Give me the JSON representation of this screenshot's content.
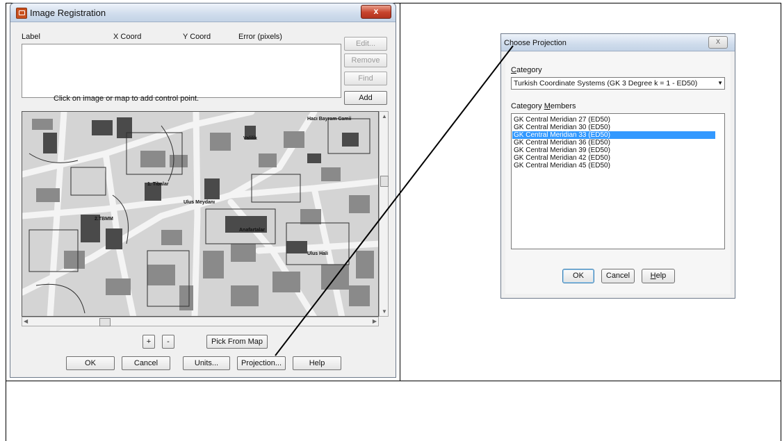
{
  "image_registration": {
    "title": "Image Registration",
    "close_label": "x",
    "columns": [
      "Label",
      "X Coord",
      "Y Coord",
      "Error (pixels)"
    ],
    "side_buttons": {
      "edit": "Edit...",
      "remove": "Remove",
      "find": "Find",
      "add": "Add"
    },
    "hint": "Click on image or map to add control point.",
    "map_labels": {
      "l1": "1. Tibalar",
      "l2": "2.TBMM",
      "l3": "Ulus Meydanı",
      "l4": "Anafartalar",
      "l5": "Hacı Bayram Camii",
      "l6": "Valilik",
      "l7": "Ulus Hali"
    },
    "zoom_in": "+",
    "zoom_out": "-",
    "pick_from_map": "Pick From Map",
    "buttons": {
      "ok": "OK",
      "cancel": "Cancel",
      "units": "Units...",
      "projection": "Projection...",
      "help": "Help"
    }
  },
  "choose_projection": {
    "title": "Choose Projection",
    "close_label": "X",
    "category_label_u": "C",
    "category_label_rest": "ategory",
    "category_value": "Turkish Coordinate Systems (GK 3 Degree k = 1 - ED50)",
    "members_label_pre": "Category ",
    "members_label_u": "M",
    "members_label_rest": "embers",
    "members": [
      "GK Central Meridian 27 (ED50)",
      "GK Central Meridian 30 (ED50)",
      "GK Central Meridian 33 (ED50)",
      "GK Central Meridian 36 (ED50)",
      "GK Central Meridian 39 (ED50)",
      "GK Central Meridian 42 (ED50)",
      "GK Central Meridian 45 (ED50)"
    ],
    "selected_index": 2,
    "buttons": {
      "ok": "OK",
      "cancel": "Cancel",
      "help_u": "H",
      "help_rest": "elp"
    }
  }
}
